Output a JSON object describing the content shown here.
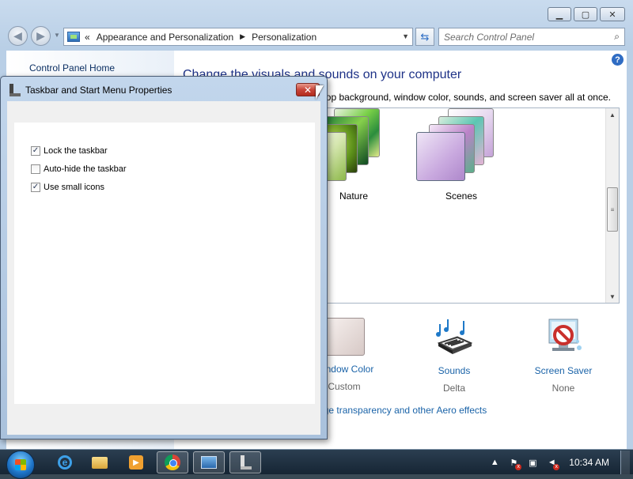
{
  "control_panel": {
    "breadcrumb": [
      "Appearance and Personalization",
      "Personalization"
    ],
    "search_placeholder": "Search Control Panel",
    "sidebar_link": "Control Panel Home",
    "heading": "Change the visuals and sounds on your computer",
    "subtitle": "Click a theme to change the desktop background, window color, sounds, and screen saver all at once.",
    "themes": [
      {
        "label": "Nature"
      },
      {
        "label": "Scenes"
      }
    ],
    "bottom_items": [
      {
        "label": "Window Color",
        "value": "Custom",
        "icon": "window-color-icon"
      },
      {
        "label": "Sounds",
        "value": "Delta",
        "icon": "sounds-icon"
      },
      {
        "label": "Screen Saver",
        "value": "None",
        "icon": "screen-saver-icon"
      }
    ],
    "aero_link": "Change transparency and other Aero effects"
  },
  "dialog": {
    "title": "Taskbar and Start Menu Properties",
    "close_label": "✕",
    "options": [
      {
        "label": "Lock the taskbar",
        "checked": true,
        "check": "✓"
      },
      {
        "label": "Auto-hide the taskbar",
        "checked": false,
        "check": ""
      },
      {
        "label": "Use small icons",
        "checked": true,
        "check": "✓"
      }
    ]
  },
  "taskbar": {
    "apps": [
      "internet-explorer-icon",
      "windows-explorer-icon",
      "media-player-icon",
      "chrome-icon",
      "control-panel-icon",
      "taskbar-properties-icon"
    ],
    "clock": "10:34 AM"
  },
  "colors": {
    "title_blue": "#1e3287",
    "link_blue": "#1a63a8",
    "close_red": "#c9463a"
  }
}
